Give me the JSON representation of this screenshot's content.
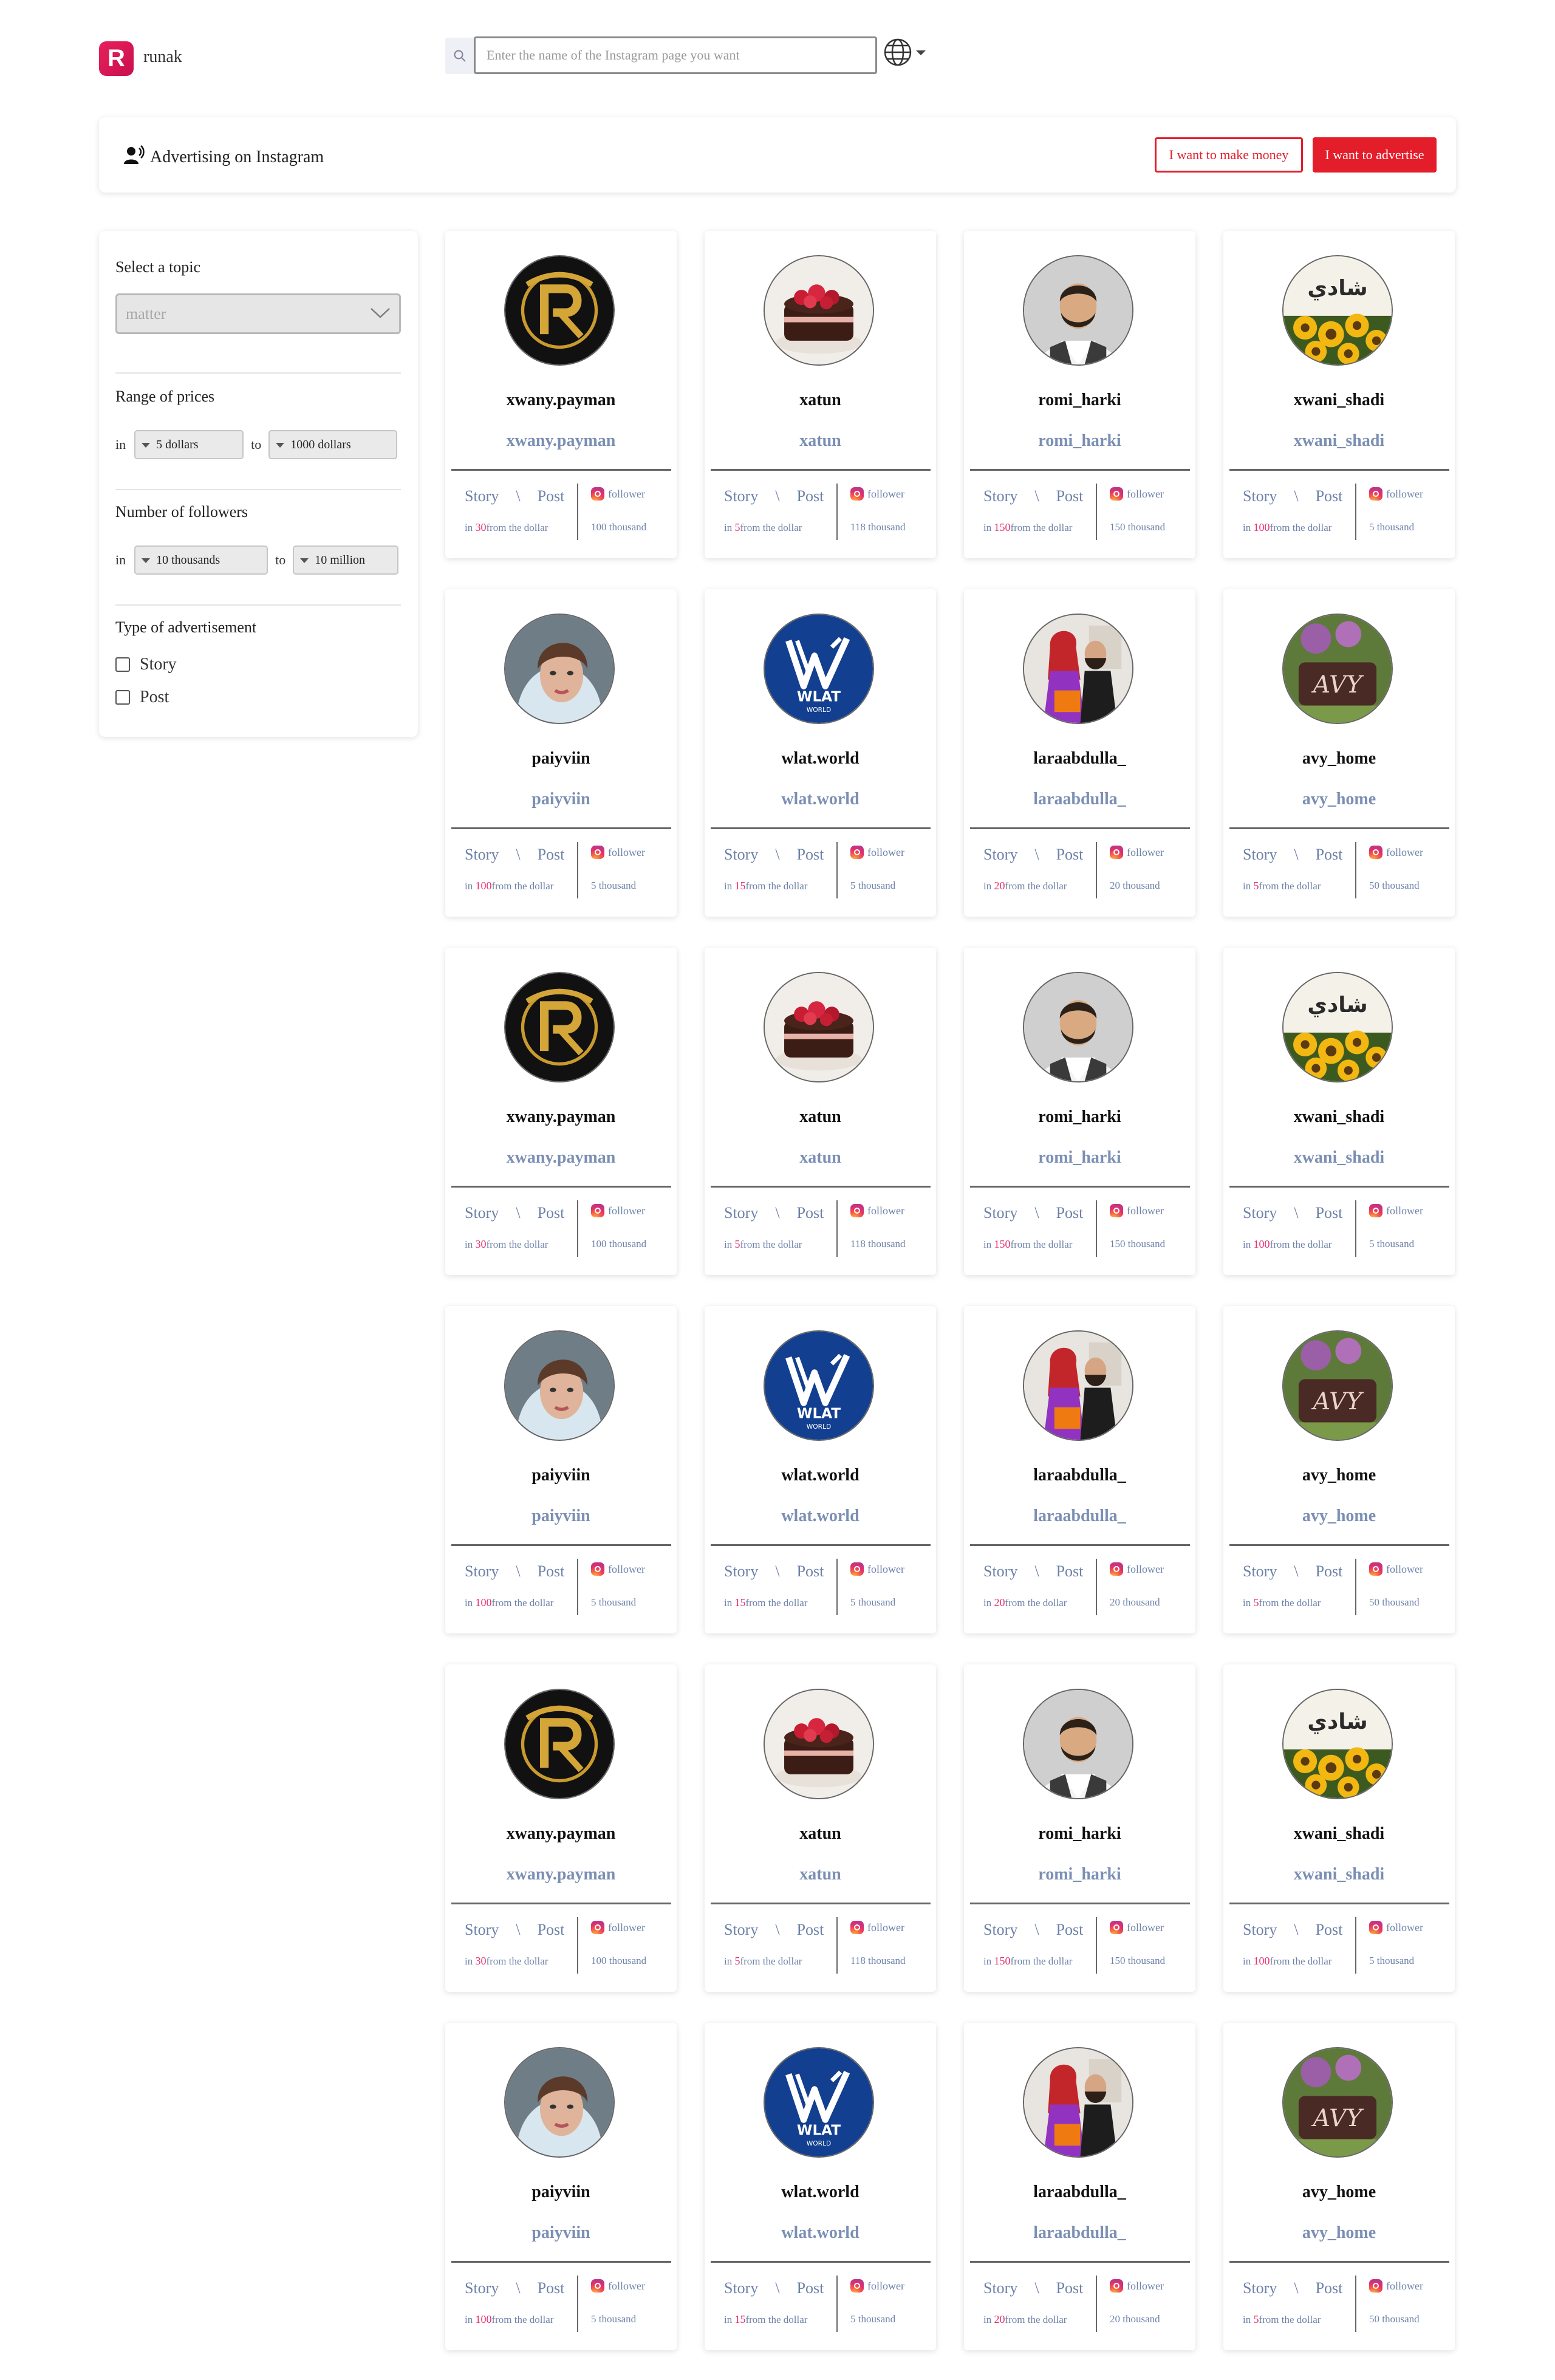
{
  "header": {
    "logo_letter": "R",
    "brand": "runak",
    "search_placeholder": "Enter the name of the Instagram page you want"
  },
  "banner": {
    "title": "Advertising on Instagram",
    "make_money_label": "I want to make money",
    "advertise_label": "I want to advertise"
  },
  "sidebar": {
    "topic_label": "Select a topic",
    "topic_value": "matter",
    "price_label": "Range of prices",
    "price_in": "in",
    "price_from": "5 dollars",
    "price_to_word": "to",
    "price_to": "1000 dollars",
    "followers_label": "Number of followers",
    "followers_in": "in",
    "followers_from": "10 thousands",
    "followers_to_word": "to",
    "followers_to": "10 million",
    "ad_type_label": "Type of advertisement",
    "story_label": "Story",
    "post_label": "Post"
  },
  "card_text": {
    "story": "Story",
    "sep": "\\",
    "post": "Post",
    "follower": "follower",
    "in": "in",
    "from_dollar": "from the dollar"
  },
  "cards": [
    {
      "name": "xwany.payman",
      "handle": "xwany.payman",
      "price": "30",
      "followers": "100 thousand",
      "avatar": "payman-logo"
    },
    {
      "name": "xatun",
      "handle": "xatun",
      "price": "5",
      "followers": "118 thousand",
      "avatar": "cake-photo"
    },
    {
      "name": "romi_harki",
      "handle": "romi_harki",
      "price": "150",
      "followers": "150 thousand",
      "avatar": "man-portrait"
    },
    {
      "name": "xwani_shadi",
      "handle": "xwani_shadi",
      "price": "100",
      "followers": "5 thousand",
      "avatar": "sunflowers"
    },
    {
      "name": "paiyviin",
      "handle": "paiyviin",
      "price": "100",
      "followers": "5 thousand",
      "avatar": "woman-selfie"
    },
    {
      "name": "wlat.world",
      "handle": "wlat.world",
      "price": "15",
      "followers": "5 thousand",
      "avatar": "wlat-logo"
    },
    {
      "name": "laraabdulla_",
      "handle": "laraabdulla_",
      "price": "20",
      "followers": "20 thousand",
      "avatar": "couple-photo"
    },
    {
      "name": "avy_home",
      "handle": "avy_home",
      "price": "5",
      "followers": "50 thousand",
      "avatar": "home-logo"
    }
  ],
  "colors": {
    "accent": "#e41d2a",
    "handle": "#7b8fb4",
    "price_number": "#e63070"
  }
}
